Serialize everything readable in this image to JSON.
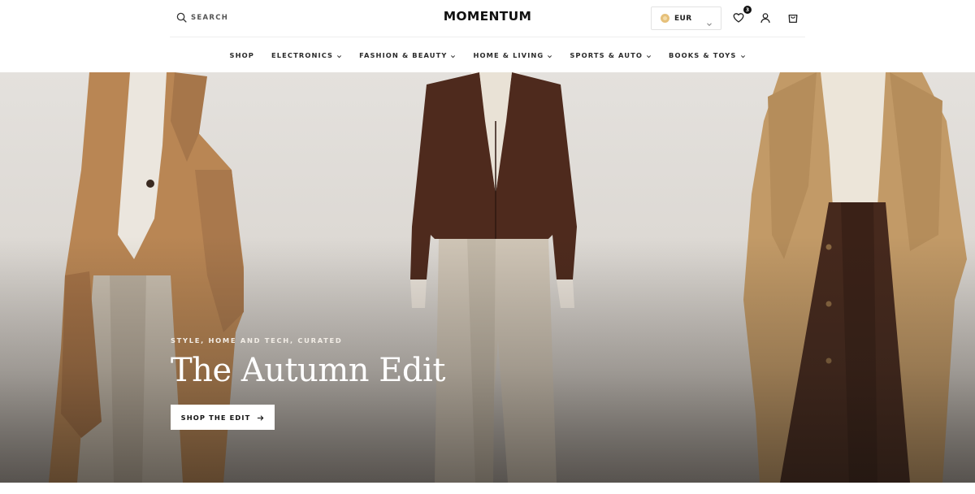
{
  "header": {
    "search_label": "SEARCH",
    "logo": "MOMENTUM",
    "currency": {
      "selected": "EUR"
    },
    "wishlist_count": "3",
    "icons": [
      "search-icon",
      "coin-icon",
      "chevron-down-icon",
      "heart-icon",
      "user-icon",
      "shopping-bag-icon"
    ]
  },
  "nav": {
    "items": [
      {
        "label": "SHOP",
        "has_dropdown": false
      },
      {
        "label": "ELECTRONICS",
        "has_dropdown": true
      },
      {
        "label": "FASHION & BEAUTY",
        "has_dropdown": true
      },
      {
        "label": "HOME & LIVING",
        "has_dropdown": true
      },
      {
        "label": "SPORTS & AUTO",
        "has_dropdown": true
      },
      {
        "label": "BOOKS & TOYS",
        "has_dropdown": true
      }
    ]
  },
  "hero": {
    "kicker": "STYLE, HOME AND TECH, CURATED",
    "title": "The Autumn Edit",
    "cta_label": "SHOP THE EDIT",
    "cta_icon": "arrow-right-icon"
  },
  "colors": {
    "text_dark": "#111111",
    "hero_text": "#ffffff",
    "camel_coat": "#b98654",
    "leather": "#4e2a1d",
    "trench": "#c29a67"
  }
}
